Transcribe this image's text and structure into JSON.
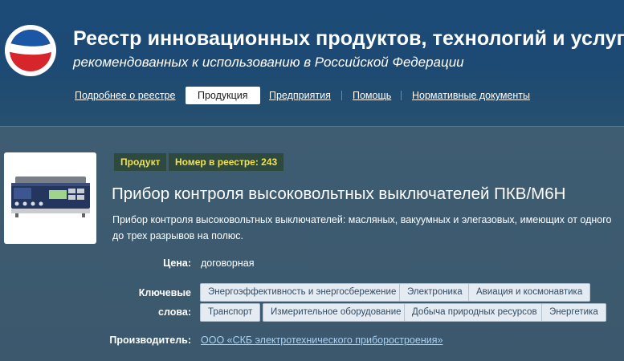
{
  "header": {
    "title": "Реестр инновационных продуктов, технологий и услуг,",
    "subtitle": "рекомендованных к использованию в Российской Федерации"
  },
  "nav": {
    "items": [
      {
        "label": "Подробнее о реестре",
        "active": false
      },
      {
        "label": "Продукция",
        "active": true
      },
      {
        "label": "Предприятия",
        "active": false
      },
      {
        "label": "Помощь",
        "active": false
      },
      {
        "label": "Нормативные документы",
        "active": false
      }
    ]
  },
  "product": {
    "badge_type": "Продукт",
    "badge_registry": "Номер в реестре: 243",
    "title": "Прибор контроля высоковольтных выключателей ПКВ/М6Н",
    "description": "Прибор контроля высоковольтных выключателей: масляных, вакуумных и элегазовых, имеющих от одного до трех разрывов на полюс.",
    "price_label": "Цена:",
    "price_value": "договорная",
    "keywords_label": "Ключевые слова:",
    "keywords": [
      "Энергоэффективность и энергосбережение",
      "Электроника",
      "Авиация и космонавтика",
      "Транспорт",
      "Измерительное оборудование",
      "Добыча природных ресурсов",
      "Энергетика"
    ],
    "manufacturer_label": "Производитель:",
    "manufacturer_value": "ООО «СКБ электротехнического приборостроения»"
  },
  "colors": {
    "header_bg": "#1c4b78",
    "content_bg": "#3d5a6f",
    "badge_bg": "#2e4a3f",
    "badge_text": "#f2e14d",
    "link": "#a8d0f2",
    "keyword_bg": "#e5ebf2"
  },
  "icons": {
    "logo": "registry-logo",
    "product_image": "device-photo"
  }
}
